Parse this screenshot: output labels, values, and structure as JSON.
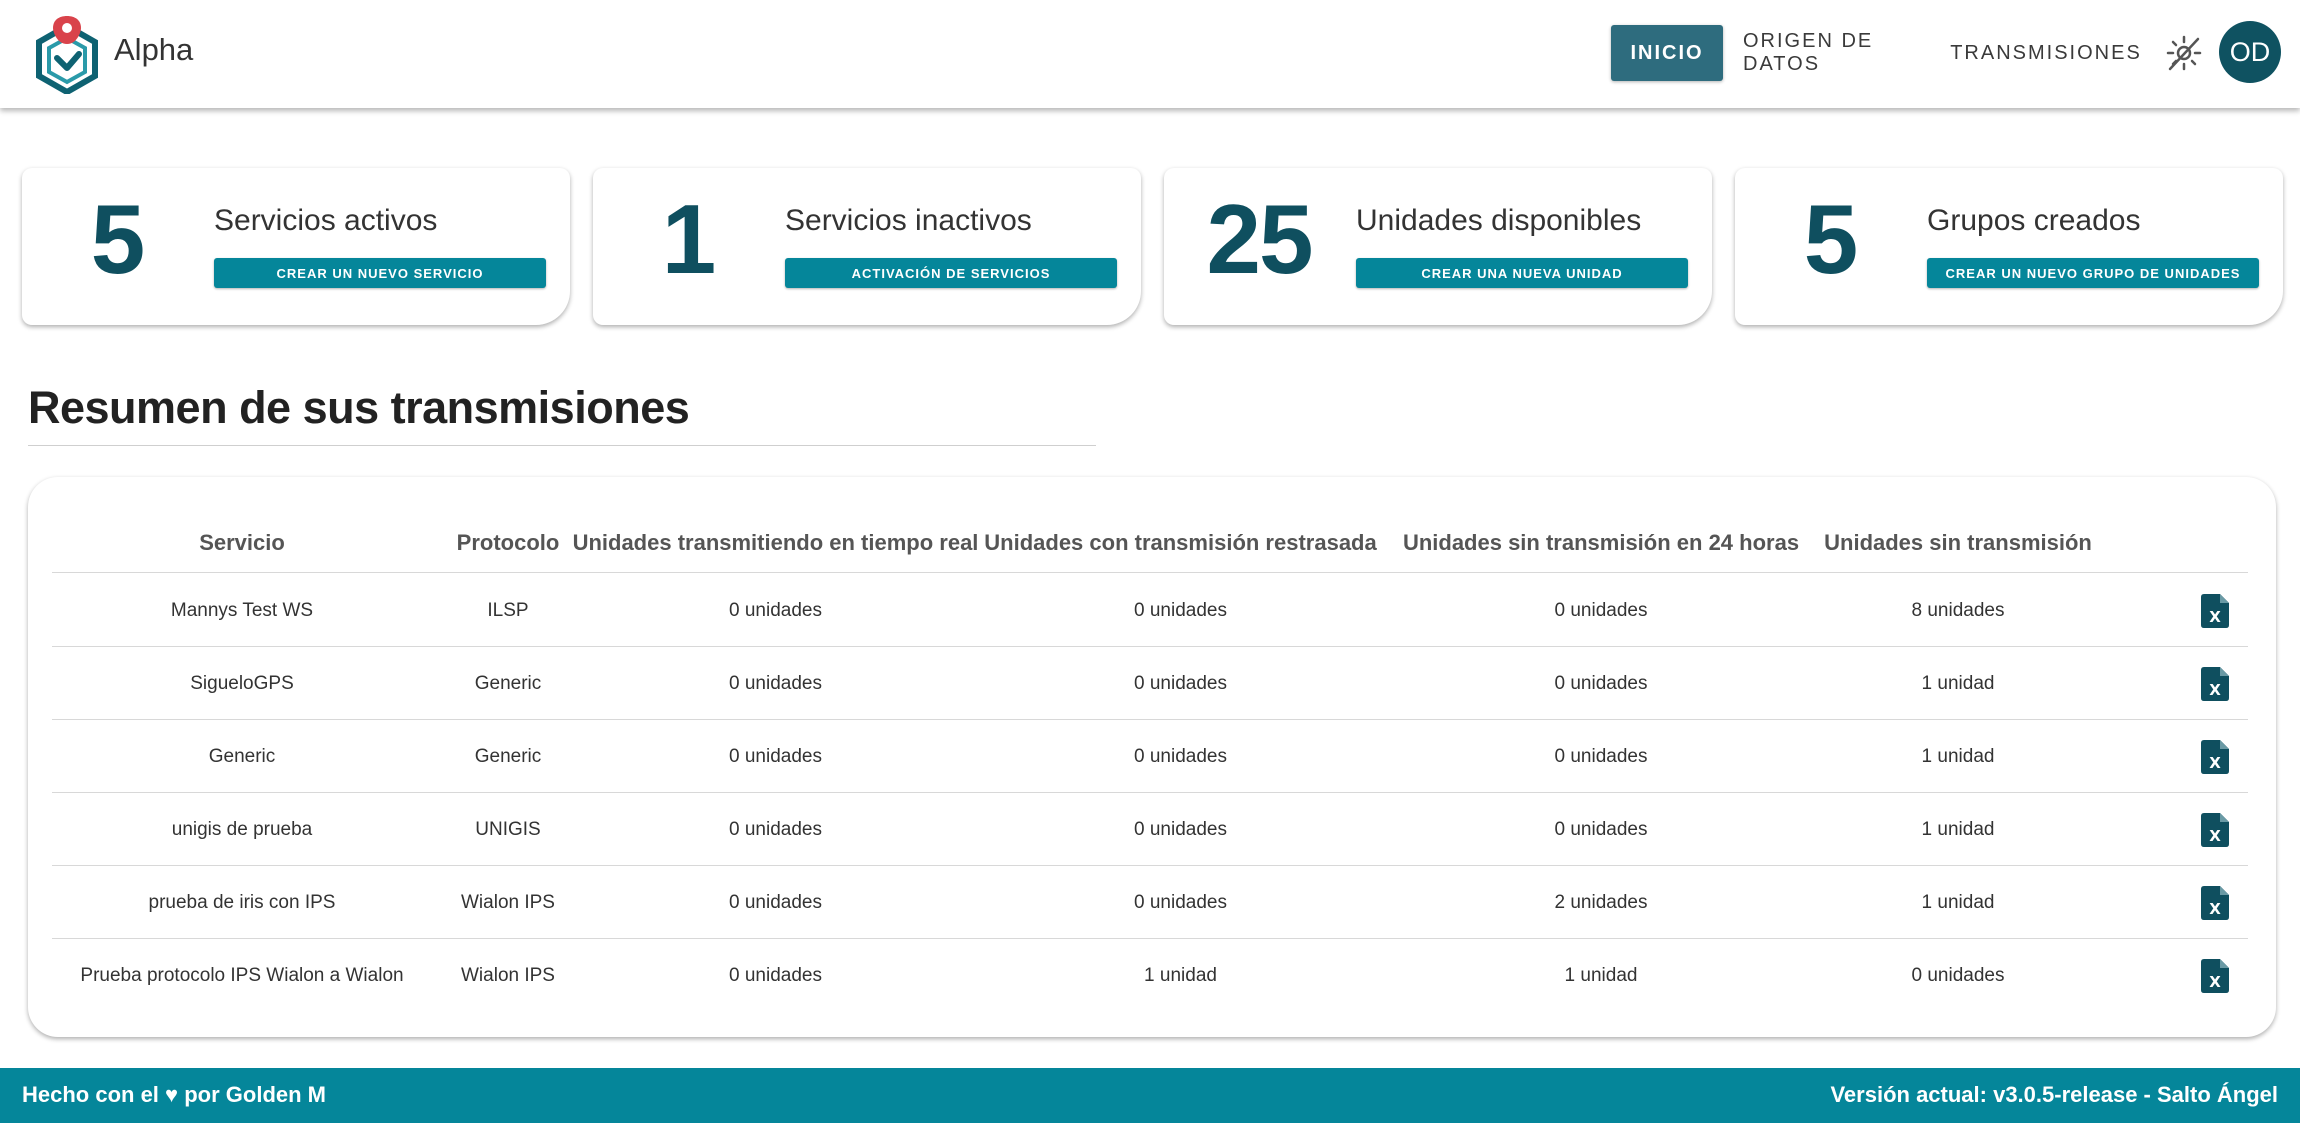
{
  "app": {
    "title": "Alpha"
  },
  "nav": {
    "items": [
      {
        "label": "INICIO",
        "active": true
      },
      {
        "label": "ORIGEN DE DATOS",
        "active": false
      },
      {
        "label": "TRANSMISIONES",
        "active": false
      }
    ],
    "theme_icon": "theme-toggle-icon",
    "avatar_initials": "OD"
  },
  "cards": [
    {
      "value": "5",
      "label": "Servicios activos",
      "button": "CREAR UN NUEVO SERVICIO"
    },
    {
      "value": "1",
      "label": "Servicios inactivos",
      "button": "ACTIVACIÓN DE SERVICIOS"
    },
    {
      "value": "25",
      "label": "Unidades disponibles",
      "button": "CREAR UNA NUEVA UNIDAD"
    },
    {
      "value": "5",
      "label": "Grupos creados",
      "button": "CREAR UN NUEVO GRUPO DE UNIDADES"
    }
  ],
  "section": {
    "title": "Resumen de sus transmisiones"
  },
  "table": {
    "headers": [
      "Servicio",
      "Protocolo",
      "Unidades transmitiendo en tiempo real",
      "Unidades con transmisión restrasada",
      "Unidades sin transmisión en 24 horas",
      "Unidades sin transmisión"
    ],
    "rows": [
      [
        "Mannys Test WS",
        "ILSP",
        "0 unidades",
        "0 unidades",
        "0 unidades",
        "8 unidades"
      ],
      [
        "SigueloGPS",
        "Generic",
        "0 unidades",
        "0 unidades",
        "0 unidades",
        "1 unidad"
      ],
      [
        "Generic",
        "Generic",
        "0 unidades",
        "0 unidades",
        "0 unidades",
        "1 unidad"
      ],
      [
        "unigis de prueba",
        "UNIGIS",
        "0 unidades",
        "0 unidades",
        "0 unidades",
        "1 unidad"
      ],
      [
        "prueba de iris con IPS",
        "Wialon IPS",
        "0 unidades",
        "0 unidades",
        "2 unidades",
        "1 unidad"
      ],
      [
        "Prueba protocolo IPS Wialon a Wialon",
        "Wialon IPS",
        "0 unidades",
        "1 unidad",
        "1 unidad",
        "0 unidades"
      ]
    ],
    "row_action_icon": "excel-export-icon"
  },
  "footer": {
    "left_prefix": "Hecho con el",
    "heart": "♥",
    "left_suffix": "por Golden M",
    "right": "Versión actual: v3.0.5-release - Salto Ángel"
  },
  "colors": {
    "primary": "#05869a",
    "dark_teal": "#0f4f5f",
    "nav_active": "#2e6c7e",
    "avatar": "#0f5261",
    "logo_red": "#d9434b"
  }
}
